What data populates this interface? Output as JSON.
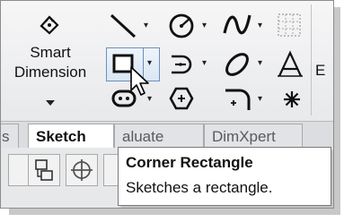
{
  "ribbon": {
    "smart_dimension": {
      "line1": "Smart",
      "line2": "Dimension"
    },
    "partial_right_label": "E",
    "tools_row1": [
      "line-icon",
      "circle-icon",
      "spline-icon",
      "grid-icon"
    ],
    "tools_row2": [
      "rectangle-icon",
      "slot-icon",
      "ellipse-icon",
      "text-icon"
    ],
    "tools_row3": [
      "straight-slot-icon",
      "polygon-icon",
      "fillet-icon",
      "point-icon"
    ]
  },
  "tabs": {
    "partial_left": "s",
    "sketch": "Sketch",
    "evaluate": "aluate",
    "dimxpert": "DimXpert"
  },
  "tooltip": {
    "title": "Corner Rectangle",
    "description": "Sketches a rectangle."
  },
  "colors": {
    "highlight_border": "#6d8fb8",
    "highlight_fill": "#d9e6f4",
    "ribbon_bg": "#eeeff1"
  }
}
